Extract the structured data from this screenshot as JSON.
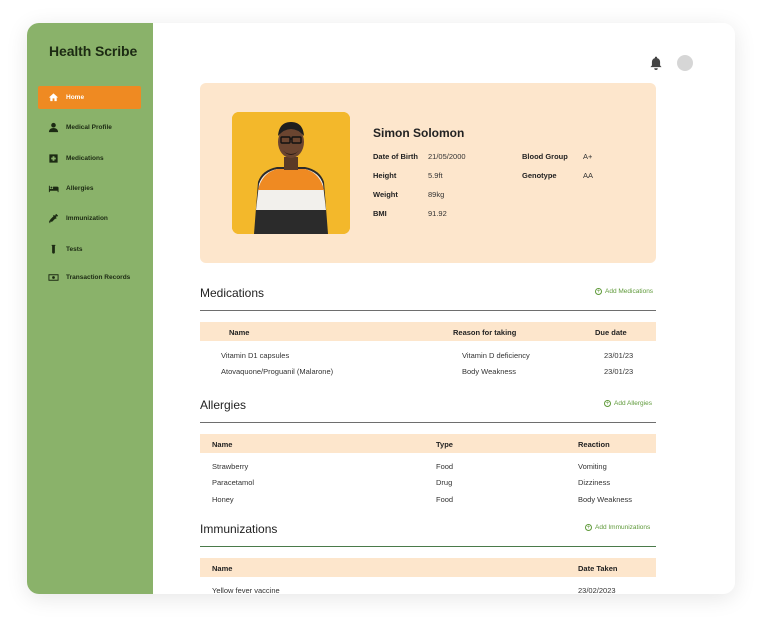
{
  "app": {
    "title": "Health Scribe"
  },
  "sidebar": {
    "items": [
      {
        "label": "Home",
        "icon": "home-icon",
        "active": true
      },
      {
        "label": "Medical Profile",
        "icon": "user-icon"
      },
      {
        "label": "Medications",
        "icon": "medical-plus-icon"
      },
      {
        "label": "Allergies",
        "icon": "bed-icon"
      },
      {
        "label": "Immunization",
        "icon": "syringe-icon"
      },
      {
        "label": "Tests",
        "icon": "test-tube-icon"
      },
      {
        "label": "Transaction Records",
        "icon": "money-icon"
      }
    ]
  },
  "header": {
    "notifications_icon": "bell-icon"
  },
  "profile": {
    "name": "Simon Solomon",
    "fields": [
      {
        "label": "Date of Birth",
        "value": "21/05/2000"
      },
      {
        "label": "Height",
        "value": "5.9ft"
      },
      {
        "label": "Weight",
        "value": "89kg"
      },
      {
        "label": "BMI",
        "value": "91.92"
      }
    ],
    "fields_right": [
      {
        "label": "Blood Group",
        "value": "A+"
      },
      {
        "label": "Genotype",
        "value": "AA"
      }
    ]
  },
  "medications": {
    "title": "Medications",
    "add_label": "Add Medications",
    "columns": [
      "Name",
      "Reason for taking",
      "Due date"
    ],
    "rows": [
      [
        "Vitamin D1 capsules",
        "Vitamin D deficiency",
        "23/01/23"
      ],
      [
        "Atovaquone/Proguanil (Malarone)",
        "Body Weakness",
        "23/01/23"
      ]
    ]
  },
  "allergies": {
    "title": "Allergies",
    "add_label": "Add Allergies",
    "columns": [
      "Name",
      "Type",
      "Reaction"
    ],
    "rows": [
      [
        "Strawberry",
        "Food",
        "Vomiting"
      ],
      [
        "Paracetamol",
        "Drug",
        "Dizziness"
      ],
      [
        "Honey",
        "Food",
        "Body Weakness"
      ]
    ]
  },
  "immunizations": {
    "title": "Immunizations",
    "add_label": "Add Immunizations",
    "columns": [
      "Name",
      "Date Taken"
    ],
    "rows": [
      [
        "Yellow fever vaccine",
        "23/02/2023"
      ]
    ]
  },
  "colors": {
    "sidebar": "#8ab26a",
    "accent": "#ef8a22",
    "card": "#fde6cc",
    "link": "#5f9a3a"
  }
}
